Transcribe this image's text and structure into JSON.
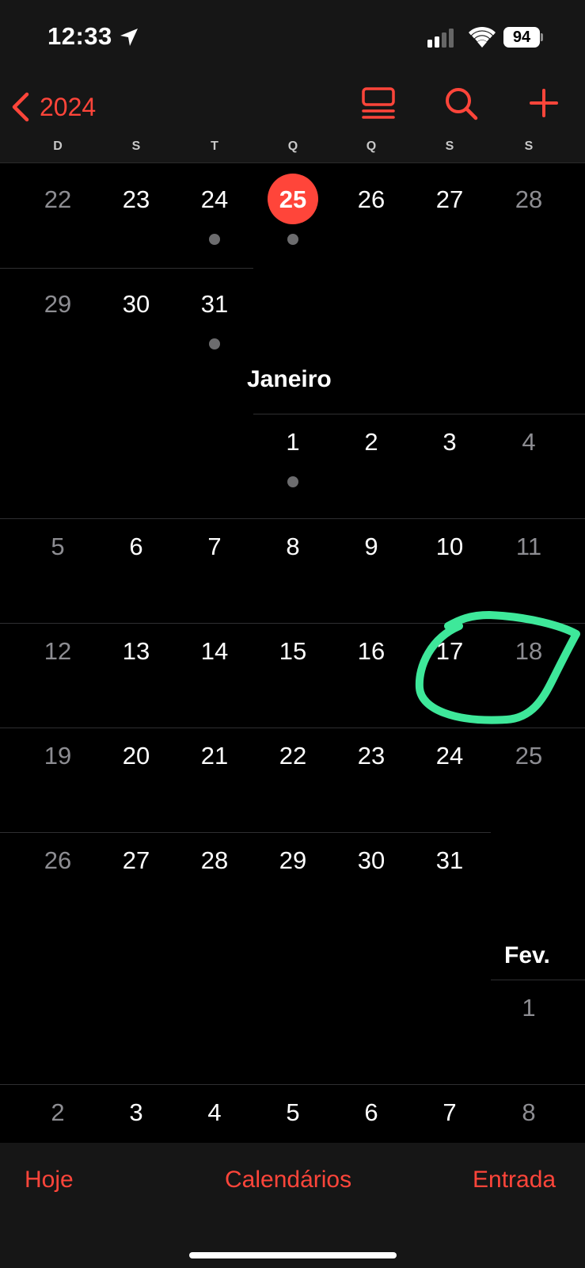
{
  "status_bar": {
    "time": "12:33",
    "battery": "94"
  },
  "nav": {
    "back_label": "2024"
  },
  "weekdays": [
    "D",
    "S",
    "T",
    "Q",
    "Q",
    "S",
    "S"
  ],
  "month_labels": {
    "january": "Janeiro",
    "february": "Fev."
  },
  "weeks": [
    {
      "days": [
        "22",
        "23",
        "24",
        "25",
        "26",
        "27",
        "28"
      ],
      "today_index": 3,
      "event_dots": [
        2,
        3
      ]
    },
    {
      "days": [
        "29",
        "30",
        "31",
        "",
        "",
        "",
        ""
      ],
      "event_dots": [
        2
      ]
    },
    {
      "days": [
        "",
        "",
        "",
        "1",
        "2",
        "3",
        "4"
      ],
      "event_dots": [
        3
      ]
    },
    {
      "days": [
        "5",
        "6",
        "7",
        "8",
        "9",
        "10",
        "11"
      ],
      "event_dots": []
    },
    {
      "days": [
        "12",
        "13",
        "14",
        "15",
        "16",
        "17",
        "18"
      ],
      "event_dots": []
    },
    {
      "days": [
        "19",
        "20",
        "21",
        "22",
        "23",
        "24",
        "25"
      ],
      "event_dots": []
    },
    {
      "days": [
        "26",
        "27",
        "28",
        "29",
        "30",
        "31",
        ""
      ],
      "event_dots": []
    },
    {
      "days": [
        "",
        "",
        "",
        "",
        "",
        "",
        "1"
      ],
      "event_dots": []
    },
    {
      "days": [
        "2",
        "3",
        "4",
        "5",
        "6",
        "7",
        "8"
      ],
      "event_dots": []
    }
  ],
  "tab_bar": {
    "today": "Hoje",
    "calendars": "Calendários",
    "inbox": "Entrada"
  },
  "colors": {
    "accent": "#ff453a",
    "annotation": "#3ee89a",
    "background": "#000000",
    "bar": "#161616"
  },
  "icons": [
    "location-arrow-icon",
    "cellular-signal-icon",
    "wifi-icon",
    "battery-icon",
    "chevron-left-icon",
    "list-view-icon",
    "search-icon",
    "add-icon"
  ]
}
